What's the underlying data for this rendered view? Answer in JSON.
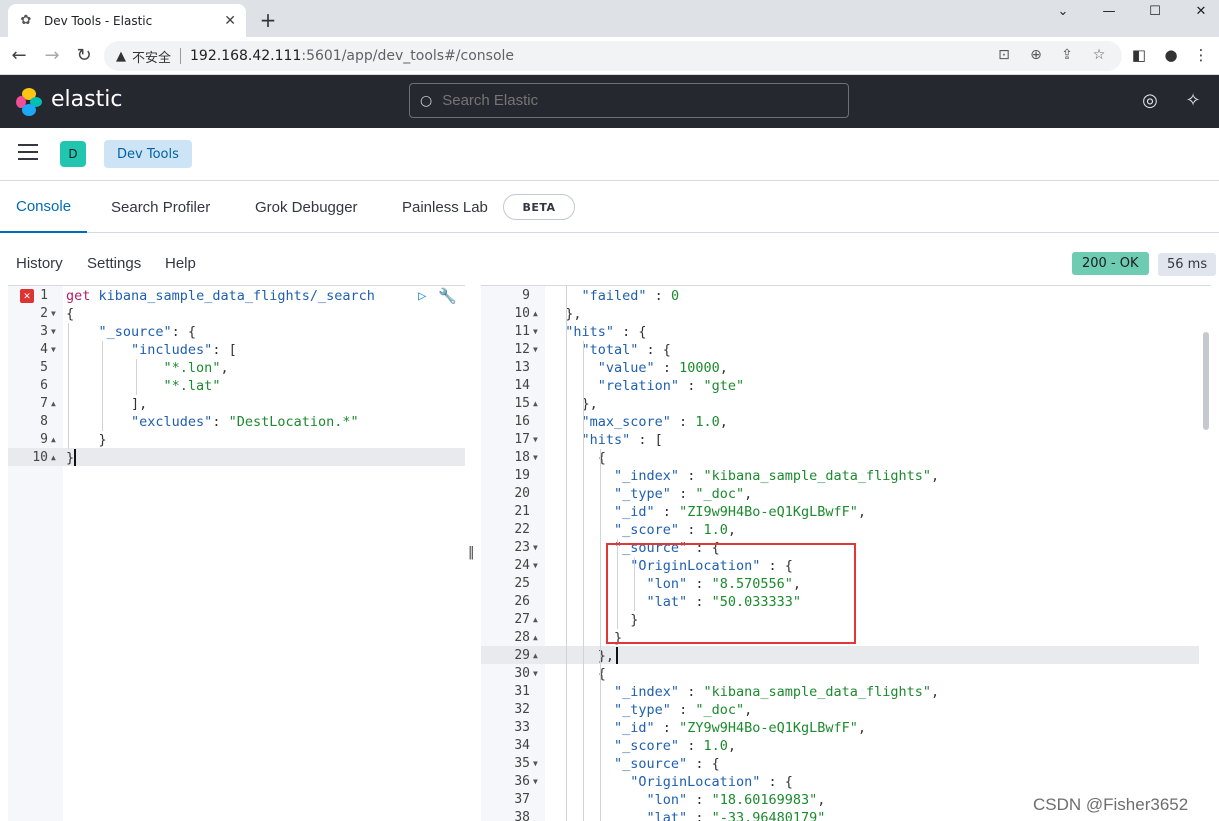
{
  "browser": {
    "tab_title": "Dev Tools - Elastic",
    "security_label": "不安全",
    "url_host": "192.168.42.111",
    "url_path": ":5601/app/dev_tools#/console"
  },
  "header": {
    "brand": "elastic",
    "search_placeholder": "Search Elastic"
  },
  "breadcrumbs": {
    "space_initial": "D",
    "current": "Dev Tools"
  },
  "tabs": [
    {
      "label": "Console",
      "active": true
    },
    {
      "label": "Search Profiler"
    },
    {
      "label": "Grok Debugger"
    },
    {
      "label": "Painless Lab"
    }
  ],
  "beta_badge": "BETA",
  "console_menu": {
    "history": "History",
    "settings": "Settings",
    "help": "Help"
  },
  "response_meta": {
    "status": "200 - OK",
    "time": "56 ms"
  },
  "request_lines": [
    {
      "num": "1",
      "tokens": [
        [
          "m",
          "get"
        ],
        [
          "p",
          " "
        ],
        [
          "u",
          "kibana_sample_data_flights/_search"
        ]
      ]
    },
    {
      "num": "2",
      "fold": "down",
      "tokens": [
        [
          "p",
          "{"
        ]
      ]
    },
    {
      "num": "3",
      "fold": "down",
      "tokens": [
        [
          "p",
          "    "
        ],
        [
          "k",
          "\"_source\""
        ],
        [
          "p",
          ": {"
        ]
      ]
    },
    {
      "num": "4",
      "fold": "down",
      "tokens": [
        [
          "p",
          "        "
        ],
        [
          "k",
          "\"includes\""
        ],
        [
          "p",
          ": ["
        ]
      ]
    },
    {
      "num": "5",
      "tokens": [
        [
          "p",
          "            "
        ],
        [
          "s",
          "\"*.lon\""
        ],
        [
          "p",
          ","
        ]
      ]
    },
    {
      "num": "6",
      "tokens": [
        [
          "p",
          "            "
        ],
        [
          "s",
          "\"*.lat\""
        ]
      ]
    },
    {
      "num": "7",
      "fold": "up",
      "tokens": [
        [
          "p",
          "        ],"
        ]
      ]
    },
    {
      "num": "8",
      "tokens": [
        [
          "p",
          "        "
        ],
        [
          "k",
          "\"excludes\""
        ],
        [
          "p",
          ": "
        ],
        [
          "s",
          "\"DestLocation.*\""
        ]
      ]
    },
    {
      "num": "9",
      "fold": "up",
      "tokens": [
        [
          "p",
          "    }"
        ]
      ]
    },
    {
      "num": "10",
      "fold": "up",
      "tokens": [
        [
          "p",
          "}"
        ]
      ]
    }
  ],
  "response_lines": [
    {
      "num": "9",
      "tokens": [
        [
          "p",
          "    "
        ],
        [
          "k",
          "\"failed\""
        ],
        [
          "p",
          " : "
        ],
        [
          "n",
          "0"
        ]
      ]
    },
    {
      "num": "10",
      "fold": "up",
      "tokens": [
        [
          "p",
          "  },"
        ]
      ]
    },
    {
      "num": "11",
      "fold": "down",
      "tokens": [
        [
          "p",
          "  "
        ],
        [
          "k",
          "\"hits\""
        ],
        [
          "p",
          " : {"
        ]
      ]
    },
    {
      "num": "12",
      "fold": "down",
      "tokens": [
        [
          "p",
          "    "
        ],
        [
          "k",
          "\"total\""
        ],
        [
          "p",
          " : {"
        ]
      ]
    },
    {
      "num": "13",
      "tokens": [
        [
          "p",
          "      "
        ],
        [
          "k",
          "\"value\""
        ],
        [
          "p",
          " : "
        ],
        [
          "n",
          "10000"
        ],
        [
          "p",
          ","
        ]
      ]
    },
    {
      "num": "14",
      "tokens": [
        [
          "p",
          "      "
        ],
        [
          "k",
          "\"relation\""
        ],
        [
          "p",
          " : "
        ],
        [
          "s",
          "\"gte\""
        ]
      ]
    },
    {
      "num": "15",
      "fold": "up",
      "tokens": [
        [
          "p",
          "    },"
        ]
      ]
    },
    {
      "num": "16",
      "tokens": [
        [
          "p",
          "    "
        ],
        [
          "k",
          "\"max_score\""
        ],
        [
          "p",
          " : "
        ],
        [
          "n",
          "1.0"
        ],
        [
          "p",
          ","
        ]
      ]
    },
    {
      "num": "17",
      "fold": "down",
      "tokens": [
        [
          "p",
          "    "
        ],
        [
          "k",
          "\"hits\""
        ],
        [
          "p",
          " : ["
        ]
      ]
    },
    {
      "num": "18",
      "fold": "down",
      "tokens": [
        [
          "p",
          "      {"
        ]
      ]
    },
    {
      "num": "19",
      "tokens": [
        [
          "p",
          "        "
        ],
        [
          "k",
          "\"_index\""
        ],
        [
          "p",
          " : "
        ],
        [
          "s",
          "\"kibana_sample_data_flights\""
        ],
        [
          "p",
          ","
        ]
      ]
    },
    {
      "num": "20",
      "tokens": [
        [
          "p",
          "        "
        ],
        [
          "k",
          "\"_type\""
        ],
        [
          "p",
          " : "
        ],
        [
          "s",
          "\"_doc\""
        ],
        [
          "p",
          ","
        ]
      ]
    },
    {
      "num": "21",
      "tokens": [
        [
          "p",
          "        "
        ],
        [
          "k",
          "\"_id\""
        ],
        [
          "p",
          " : "
        ],
        [
          "s",
          "\"ZI9w9H4Bo-eQ1KgLBwfF\""
        ],
        [
          "p",
          ","
        ]
      ]
    },
    {
      "num": "22",
      "tokens": [
        [
          "p",
          "        "
        ],
        [
          "k",
          "\"_score\""
        ],
        [
          "p",
          " : "
        ],
        [
          "n",
          "1.0"
        ],
        [
          "p",
          ","
        ]
      ]
    },
    {
      "num": "23",
      "fold": "down",
      "tokens": [
        [
          "p",
          "        "
        ],
        [
          "k",
          "\"_source\""
        ],
        [
          "p",
          " : {"
        ]
      ]
    },
    {
      "num": "24",
      "fold": "down",
      "tokens": [
        [
          "p",
          "          "
        ],
        [
          "k",
          "\"OriginLocation\""
        ],
        [
          "p",
          " : {"
        ]
      ]
    },
    {
      "num": "25",
      "tokens": [
        [
          "p",
          "            "
        ],
        [
          "k",
          "\"lon\""
        ],
        [
          "p",
          " : "
        ],
        [
          "s",
          "\"8.570556\""
        ],
        [
          "p",
          ","
        ]
      ]
    },
    {
      "num": "26",
      "tokens": [
        [
          "p",
          "            "
        ],
        [
          "k",
          "\"lat\""
        ],
        [
          "p",
          " : "
        ],
        [
          "s",
          "\"50.033333\""
        ]
      ]
    },
    {
      "num": "27",
      "fold": "up",
      "tokens": [
        [
          "p",
          "          }"
        ]
      ]
    },
    {
      "num": "28",
      "fold": "up",
      "tokens": [
        [
          "p",
          "        }"
        ]
      ]
    },
    {
      "num": "29",
      "fold": "up",
      "tokens": [
        [
          "p",
          "      },"
        ]
      ]
    },
    {
      "num": "30",
      "fold": "down",
      "tokens": [
        [
          "p",
          "      {"
        ]
      ]
    },
    {
      "num": "31",
      "tokens": [
        [
          "p",
          "        "
        ],
        [
          "k",
          "\"_index\""
        ],
        [
          "p",
          " : "
        ],
        [
          "s",
          "\"kibana_sample_data_flights\""
        ],
        [
          "p",
          ","
        ]
      ]
    },
    {
      "num": "32",
      "tokens": [
        [
          "p",
          "        "
        ],
        [
          "k",
          "\"_type\""
        ],
        [
          "p",
          " : "
        ],
        [
          "s",
          "\"_doc\""
        ],
        [
          "p",
          ","
        ]
      ]
    },
    {
      "num": "33",
      "tokens": [
        [
          "p",
          "        "
        ],
        [
          "k",
          "\"_id\""
        ],
        [
          "p",
          " : "
        ],
        [
          "s",
          "\"ZY9w9H4Bo-eQ1KgLBwfF\""
        ],
        [
          "p",
          ","
        ]
      ]
    },
    {
      "num": "34",
      "tokens": [
        [
          "p",
          "        "
        ],
        [
          "k",
          "\"_score\""
        ],
        [
          "p",
          " : "
        ],
        [
          "n",
          "1.0"
        ],
        [
          "p",
          ","
        ]
      ]
    },
    {
      "num": "35",
      "fold": "down",
      "tokens": [
        [
          "p",
          "        "
        ],
        [
          "k",
          "\"_source\""
        ],
        [
          "p",
          " : {"
        ]
      ]
    },
    {
      "num": "36",
      "fold": "down",
      "tokens": [
        [
          "p",
          "          "
        ],
        [
          "k",
          "\"OriginLocation\""
        ],
        [
          "p",
          " : {"
        ]
      ]
    },
    {
      "num": "37",
      "tokens": [
        [
          "p",
          "            "
        ],
        [
          "k",
          "\"lon\""
        ],
        [
          "p",
          " : "
        ],
        [
          "s",
          "\"18.60169983\""
        ],
        [
          "p",
          ","
        ]
      ]
    },
    {
      "num": "38",
      "tokens": [
        [
          "p",
          "            "
        ],
        [
          "k",
          "\"lat\""
        ],
        [
          "p",
          " : "
        ],
        [
          "s",
          "\"-33.96480179\""
        ]
      ]
    }
  ],
  "watermark": "CSDN @Fisher3652"
}
